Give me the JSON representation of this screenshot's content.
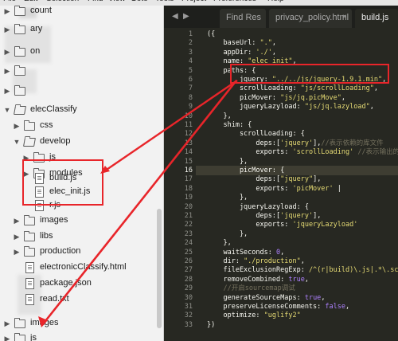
{
  "menu": [
    "File",
    "Edit",
    "Selection",
    "Find",
    "View",
    "Goto",
    "Tools",
    "Project",
    "Preferences",
    "Help"
  ],
  "sidebar": {
    "rows": [
      {
        "label": "count",
        "type": "folder",
        "state": "collapsed"
      },
      {
        "label": "ary",
        "type": "folder",
        "state": "collapsed"
      },
      {
        "label": "on",
        "type": "folder",
        "state": "collapsed"
      },
      {
        "label": "",
        "type": "folder",
        "state": "collapsed"
      },
      {
        "label": "",
        "type": "folder",
        "state": "collapsed"
      },
      {
        "label": "elecClassify",
        "type": "folder",
        "state": "expanded"
      },
      {
        "label": "css",
        "type": "folder",
        "state": "collapsed"
      },
      {
        "label": "develop",
        "type": "folder",
        "state": "expanded"
      },
      {
        "label": "js",
        "type": "folder",
        "state": "collapsed"
      },
      {
        "label": "modules",
        "type": "folder",
        "state": "collapsed"
      },
      {
        "label": "build.js",
        "type": "file"
      },
      {
        "label": "elec_init.js",
        "type": "file"
      },
      {
        "label": "r.js",
        "type": "file"
      },
      {
        "label": "images",
        "type": "folder",
        "state": "collapsed"
      },
      {
        "label": "libs",
        "type": "folder",
        "state": "collapsed"
      },
      {
        "label": "production",
        "type": "folder",
        "state": "collapsed"
      },
      {
        "label": "electronicClassify.html",
        "type": "file"
      },
      {
        "label": "package.json",
        "type": "file"
      },
      {
        "label": "read.txt",
        "type": "file"
      },
      {
        "label": "images",
        "type": "folder",
        "state": "collapsed"
      },
      {
        "label": "js",
        "type": "folder",
        "state": "collapsed"
      }
    ]
  },
  "editor": {
    "tabs": [
      {
        "label": "Find Res",
        "active": false
      },
      {
        "label": "privacy_policy.html",
        "active": false,
        "close": "×"
      },
      {
        "label": "build.js",
        "active": true
      }
    ],
    "current_line": 16,
    "lines": [
      [
        [
          "k",
          "({"
        ]
      ],
      [
        [
          "k",
          "    baseUrl: "
        ],
        [
          "s",
          "\".\""
        ],
        [
          "k",
          ","
        ]
      ],
      [
        [
          "k",
          "    appDir: "
        ],
        [
          "s",
          "'./'"
        ],
        [
          "k",
          ","
        ]
      ],
      [
        [
          "k",
          "    name: "
        ],
        [
          "s",
          "\"elec_init\""
        ],
        [
          "k",
          ","
        ]
      ],
      [
        [
          "k",
          "    paths: {"
        ]
      ],
      [
        [
          "k",
          "        jquery: "
        ],
        [
          "s",
          "\"../../js/jquery-1.9.1.min\""
        ],
        [
          "k",
          ","
        ]
      ],
      [
        [
          "k",
          "        scrollLoading: "
        ],
        [
          "s",
          "\"js/scrollLoading\""
        ],
        [
          "k",
          ","
        ]
      ],
      [
        [
          "k",
          "        picMover: "
        ],
        [
          "s",
          "\"js/jq.picMove\""
        ],
        [
          "k",
          ","
        ]
      ],
      [
        [
          "k",
          "        jqueryLazyload: "
        ],
        [
          "s",
          "\"js/jq.lazyload\""
        ],
        [
          "k",
          ","
        ]
      ],
      [
        [
          "k",
          "    },"
        ]
      ],
      [
        [
          "k",
          "    shim: {"
        ]
      ],
      [
        [
          "k",
          "        scrollLoading: {"
        ]
      ],
      [
        [
          "k",
          "            deps:["
        ],
        [
          "s",
          "'jquery'"
        ],
        [
          "k",
          "],"
        ],
        [
          "c",
          "//表示依赖的库文件"
        ]
      ],
      [
        [
          "k",
          "            exports: "
        ],
        [
          "s",
          "'scrollLoading'"
        ],
        [
          "k",
          " "
        ],
        [
          "c",
          "//表示输出的"
        ]
      ],
      [
        [
          "k",
          "        },"
        ]
      ],
      [
        [
          "k",
          "        picMover: {"
        ]
      ],
      [
        [
          "k",
          "            deps:["
        ],
        [
          "s",
          "\"jquery\""
        ],
        [
          "k",
          "],"
        ]
      ],
      [
        [
          "k",
          "            exports: "
        ],
        [
          "s",
          "'picMover'"
        ],
        [
          "k",
          " |"
        ]
      ],
      [
        [
          "k",
          "        },"
        ]
      ],
      [
        [
          "k",
          "        jqueryLazyload: {"
        ]
      ],
      [
        [
          "k",
          "            deps:["
        ],
        [
          "s",
          "'jquery'"
        ],
        [
          "k",
          "],"
        ]
      ],
      [
        [
          "k",
          "            exports: "
        ],
        [
          "s",
          "'jqueryLazyload'"
        ]
      ],
      [
        [
          "k",
          "        },"
        ]
      ],
      [
        [
          "k",
          "    },"
        ]
      ],
      [
        [
          "k",
          "    waitSeconds: "
        ],
        [
          "n",
          "0"
        ],
        [
          "k",
          ","
        ]
      ],
      [
        [
          "k",
          "    dir: "
        ],
        [
          "s",
          "\"./production\""
        ],
        [
          "k",
          ","
        ]
      ],
      [
        [
          "k",
          "    fileExclusionRegExp: "
        ],
        [
          "r",
          "/^(r|build)\\.js|.*\\.scss"
        ]
      ],
      [
        [
          "k",
          "    removeCombined: "
        ],
        [
          "n",
          "true"
        ],
        [
          "k",
          ","
        ]
      ],
      [
        [
          "c",
          "    //开启sourcemap调试"
        ]
      ],
      [
        [
          "k",
          "    generateSourceMaps: "
        ],
        [
          "n",
          "true"
        ],
        [
          "k",
          ","
        ]
      ],
      [
        [
          "k",
          "    preserveLicenseComments: "
        ],
        [
          "n",
          "false"
        ],
        [
          "k",
          ","
        ]
      ],
      [
        [
          "k",
          "    optimize: "
        ],
        [
          "s",
          "\"uglify2\""
        ]
      ],
      [
        [
          "k",
          "})"
        ]
      ]
    ]
  },
  "colors": {
    "highlight": "#e8252a",
    "editor_bg": "#272822",
    "string": "#e6db74",
    "comment": "#75715e",
    "number": "#ae81ff"
  }
}
